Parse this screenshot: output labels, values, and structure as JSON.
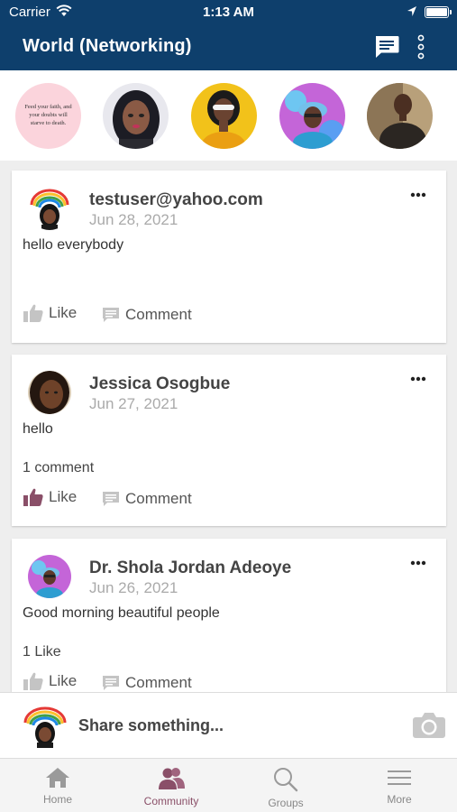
{
  "status_bar": {
    "carrier": "Carrier",
    "time": "1:13 AM"
  },
  "header": {
    "title": "World (Networking)"
  },
  "stories": [
    {
      "type": "quote",
      "text": "Feed your faith, and your doubts will starve to death."
    },
    {
      "type": "photo"
    },
    {
      "type": "photo"
    },
    {
      "type": "photo"
    },
    {
      "type": "photo"
    }
  ],
  "posts": [
    {
      "author": "testuser@yahoo.com",
      "date": "Jun 28, 2021",
      "body": "hello everybody",
      "count": "",
      "like_label": "Like",
      "comment_label": "Comment"
    },
    {
      "author": "Jessica Osogbue",
      "date": "Jun 27, 2021",
      "body": "hello",
      "count": "1 comment",
      "like_label": "Like",
      "comment_label": "Comment"
    },
    {
      "author": "Dr. Shola Jordan Adeoye",
      "date": "Jun 26, 2021",
      "body": "Good morning beautiful people",
      "count": "1 Like",
      "like_label": "Like",
      "comment_label": "Comment"
    }
  ],
  "composer": {
    "placeholder": "Share something..."
  },
  "tabs": [
    {
      "label": "Home",
      "icon": "home-icon"
    },
    {
      "label": "Community",
      "icon": "community-icon",
      "active": true
    },
    {
      "label": "Groups",
      "icon": "search-icon"
    },
    {
      "label": "More",
      "icon": "menu-icon"
    }
  ],
  "colors": {
    "header": "#0e3f6c",
    "accent": "#8a4f68",
    "like_active": "#8a4f68",
    "inactive": "#aaaaaa"
  }
}
